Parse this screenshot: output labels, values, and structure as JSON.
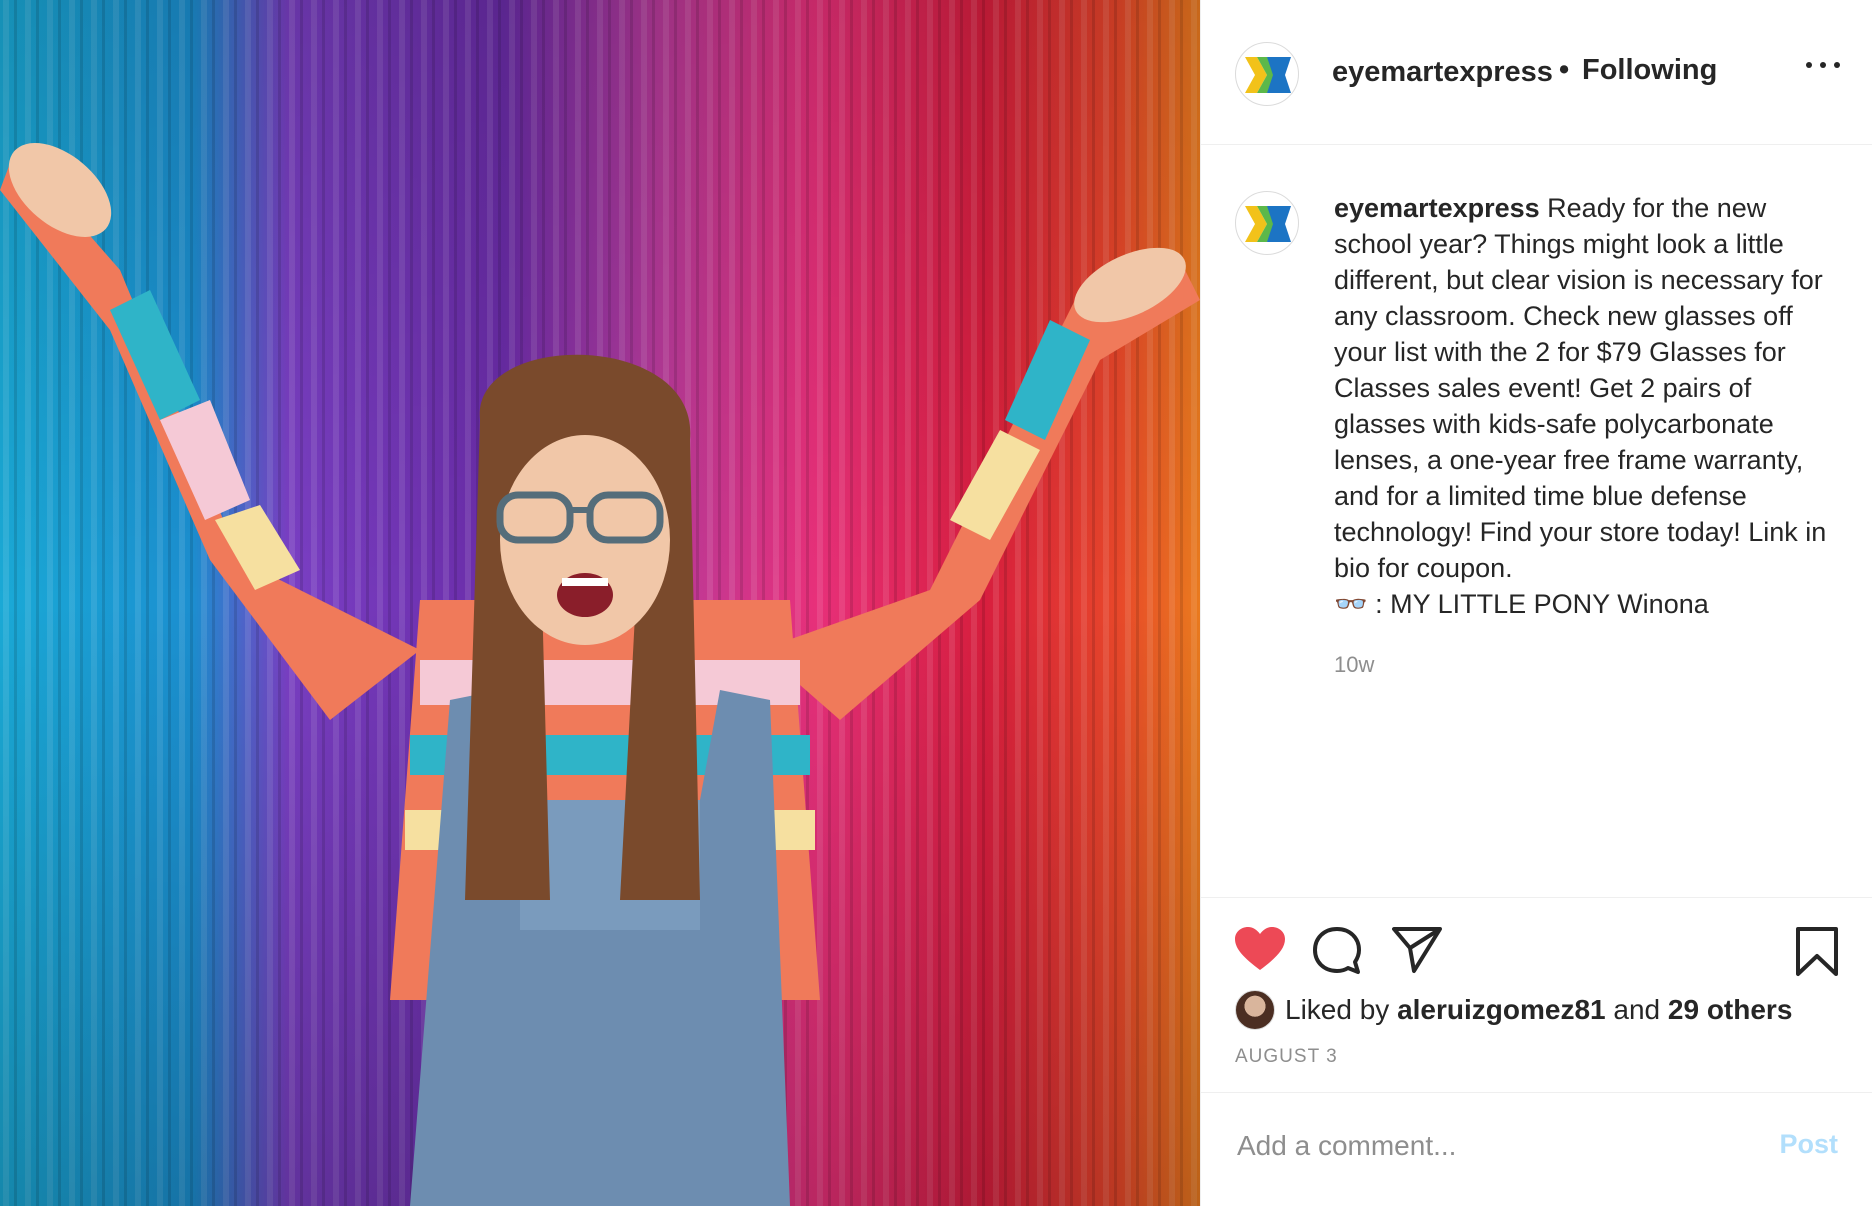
{
  "post": {
    "username": "eyemartexpress",
    "separator": "•",
    "follow_status": "Following",
    "caption_username": "eyemartexpress",
    "caption_text": "Ready for the new school year? Things might look a little different, but clear vision is necessary for any classroom. Check new glasses off your list with the 2 for $79 Glasses for Classes sales event! Get 2 pairs of glasses with kids-safe polycarbonate lenses, a one-year free frame warranty, and for a limited time blue defense technology! Find your store today! Link in bio for coupon.",
    "caption_credit": "👓 : MY LITTLE PONY Winona",
    "age": "10w",
    "liked_prefix": "Liked by",
    "liked_user": "aleruizgomez81",
    "liked_and": "and",
    "liked_others": "29 others",
    "date": "AUGUST 3"
  },
  "comment": {
    "placeholder": "Add a comment...",
    "post_label": "Post"
  },
  "icons": {
    "more": "more-options-icon",
    "like": "heart-icon",
    "comment": "comment-icon",
    "share": "share-icon",
    "save": "bookmark-icon"
  },
  "colors": {
    "like_red": "#ed4956",
    "post_disabled_blue": "#b2dffc",
    "meta_grey": "#8e8e8e"
  }
}
